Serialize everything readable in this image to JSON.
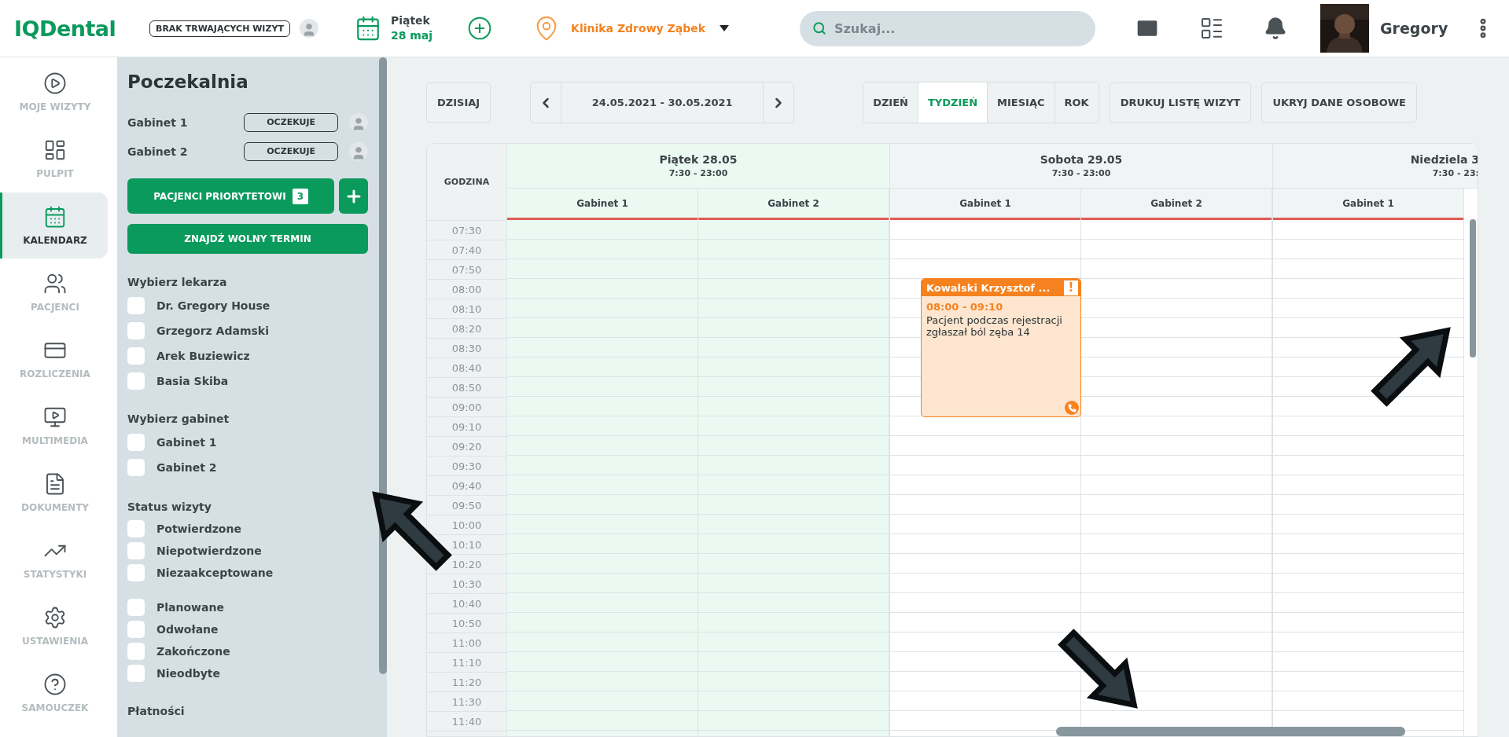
{
  "topbar": {
    "logo": "IQDental",
    "visit_status": "BRAK TRWAJĄCYCH WIZYT",
    "day_name": "Piątek",
    "date": "28 maj",
    "clinic": "Klinika Zdrowy Ząbek",
    "search": {
      "placeholder": "Szukaj..."
    },
    "user": "Gregory"
  },
  "nav": [
    {
      "label": "MOJE WIZYTY",
      "selected": false
    },
    {
      "label": "PULPIT",
      "selected": false
    },
    {
      "label": "KALENDARZ",
      "selected": true
    },
    {
      "label": "PACJENCI",
      "selected": false
    },
    {
      "label": "ROZLICZENIA",
      "selected": false
    },
    {
      "label": "MULTIMEDIA",
      "selected": false
    },
    {
      "label": "DOKUMENTY",
      "selected": false
    },
    {
      "label": "STATYSTYKI",
      "selected": false
    },
    {
      "label": "USTAWIENIA",
      "selected": false
    },
    {
      "label": "SAMOUCZEK",
      "selected": false
    }
  ],
  "waiting_room": {
    "title": "Poczekalnia",
    "rooms": [
      {
        "name": "Gabinet 1",
        "status": "OCZEKUJE"
      },
      {
        "name": "Gabinet 2",
        "status": "OCZEKUJE"
      }
    ],
    "priority_button": "PACJENCI PRIORYTETOWI",
    "priority_count": "3",
    "find_button": "ZNAJDŹ WOLNY TERMIN",
    "filters": [
      {
        "title": "Wybierz lekarza",
        "groups": [
          [
            {
              "label": "Dr. Gregory House",
              "checked": false
            },
            {
              "label": "Grzegorz Adamski",
              "checked": false
            },
            {
              "label": "Arek Buziewicz",
              "checked": false
            },
            {
              "label": "Basia Skiba",
              "checked": false
            }
          ]
        ]
      },
      {
        "title": "Wybierz gabinet",
        "groups": [
          [
            {
              "label": "Gabinet 1",
              "checked": false
            },
            {
              "label": "Gabinet 2",
              "checked": false
            }
          ]
        ]
      },
      {
        "title": "Status wizyty",
        "groups": [
          [
            {
              "label": "Potwierdzone",
              "checked": false
            },
            {
              "label": "Niepotwierdzone",
              "checked": false
            },
            {
              "label": "Niezaakceptowane",
              "checked": false
            }
          ],
          [
            {
              "label": "Planowane",
              "checked": false
            },
            {
              "label": "Odwołane",
              "checked": false
            },
            {
              "label": "Zakończone",
              "checked": false
            },
            {
              "label": "Nieodbyte",
              "checked": false
            }
          ]
        ]
      },
      {
        "title": "Płatności"
      }
    ]
  },
  "calendar": {
    "today_button": "DZISIAJ",
    "range": "24.05.2021 - 30.05.2021",
    "views": [
      {
        "label": "DZIEŃ",
        "selected": false
      },
      {
        "label": "TYDZIEŃ",
        "selected": true
      },
      {
        "label": "MIESIĄC",
        "selected": false
      },
      {
        "label": "ROK",
        "selected": false
      }
    ],
    "actions": [
      "DRUKUJ LISTĘ WIZYT",
      "UKRYJ DANE OSOBOWE"
    ],
    "hour_header": "GODZINA",
    "days": [
      {
        "title": "Piątek 28.05",
        "hours": "7:30 - 23:00",
        "today": true,
        "cut": false,
        "rooms": [
          {
            "name": "Gabinet 1"
          },
          {
            "name": "Gabinet 2"
          }
        ]
      },
      {
        "title": "Sobota 29.05",
        "hours": "7:30 - 23:00",
        "today": false,
        "cut": false,
        "rooms": [
          {
            "name": "Gabinet 1",
            "events": [
              {
                "title": "Kowalski Krzysztof ...",
                "flag": "!",
                "time": "08:00 - 09:10",
                "note": "Pacjent podczas rejestracji zgłaszał ból zęba 14"
              }
            ]
          },
          {
            "name": "Gabinet 2"
          }
        ]
      },
      {
        "title": "Niedziela 3",
        "hours": "7:30 - 23:",
        "today": false,
        "cut": true,
        "rooms": [
          {
            "name": "Gabinet 1"
          }
        ]
      }
    ],
    "times": [
      "07:30",
      "07:40",
      "07:50",
      "08:00",
      "08:10",
      "08:20",
      "08:30",
      "08:40",
      "08:50",
      "09:00",
      "09:10",
      "09:20",
      "09:30",
      "09:40",
      "09:50",
      "10:00",
      "10:10",
      "10:20",
      "10:30",
      "10:40",
      "10:50",
      "11:00",
      "11:10",
      "11:20",
      "11:30",
      "11:40"
    ]
  }
}
